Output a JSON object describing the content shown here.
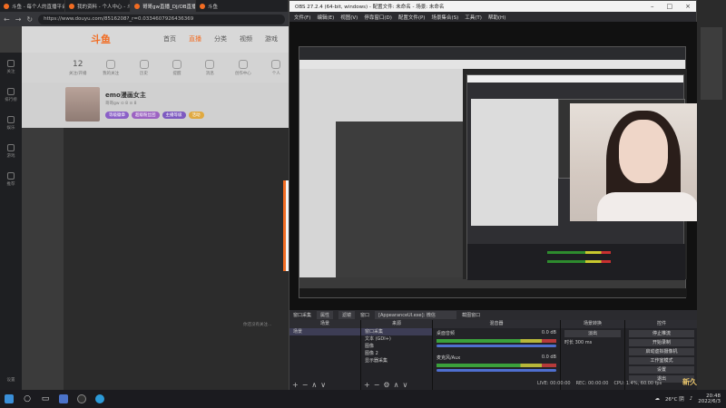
{
  "browser": {
    "tabs": [
      {
        "label": "斗鱼 - 每个人的直播平台"
      },
      {
        "label": "我的资料 - 个人中心 - 斗鱼"
      },
      {
        "label": "哥哥gw直播_DJ/OB直播_斗鱼..."
      },
      {
        "label": "斗鱼"
      }
    ],
    "url": "https://www.douyu.com/8516208?_r=0.0334607926436369"
  },
  "douyu": {
    "logo": "斗鱼",
    "menu": [
      "首页",
      "直播",
      "分类",
      "视频",
      "游戏"
    ],
    "icon_row": [
      {
        "num": "12",
        "label": "关注/开播"
      },
      {
        "label": "我的关注"
      },
      {
        "label": "历史"
      },
      {
        "label": "提醒"
      },
      {
        "label": "消息"
      },
      {
        "label": "创作中心"
      },
      {
        "label": "个人"
      }
    ],
    "anchor": {
      "name": "emo漫画女主",
      "meta": "哥哥gw ⊙ 8 ⊙ 8",
      "badges": [
        "等级徽章",
        "超级粉丝团",
        "主播等级",
        "活动"
      ]
    },
    "sidebar": [
      "关注",
      "排行榜",
      "娱乐",
      "游戏",
      "推荐"
    ],
    "sidebar_bottom": "设置",
    "hint": "你还没有关注..."
  },
  "obs": {
    "title": "OBS 27.2.4 (64-bit, windows) - 配置文件: 未命名 - 场景: 未命名",
    "menu": [
      "文件(F)",
      "编辑(E)",
      "视图(V)",
      "停靠窗口(D)",
      "配置文件(P)",
      "场景集合(S)",
      "工具(T)",
      "帮助(H)"
    ],
    "dock_bar": {
      "window_capture": "窗口采集",
      "props": "属性",
      "filters": "滤镜",
      "window": "窗口",
      "window_value": "[AppearanceUI.exe]: 微信",
      "capture_title": "截图窗口"
    },
    "scenes": {
      "title": "场景",
      "items": [
        "场景"
      ]
    },
    "sources": {
      "title": "来源",
      "items": [
        "窗口采集",
        "文本 (GDI+)",
        "图像",
        "图像 2",
        "显示器采集"
      ]
    },
    "mixer": {
      "title": "混音器",
      "channels": [
        {
          "name": "桌面音频",
          "db": "0.0 dB"
        },
        {
          "name": "麦克风/Aux",
          "db": "0.0 dB"
        }
      ]
    },
    "transitions": {
      "title": "场景转换",
      "type": "淡出",
      "duration_label": "时长",
      "duration": "300 ms"
    },
    "controls": {
      "title": "控件",
      "buttons": [
        "停止推流",
        "开始录制",
        "启动虚拟摄像机",
        "工作室模式",
        "设置",
        "退出"
      ]
    },
    "status": {
      "live": "LIVE: 00:00:00",
      "rec": "REC: 00:00:00",
      "cpu": "CPU: 1.4%, 60.00 fps"
    }
  },
  "watermark": "新久",
  "taskbar": {
    "weather": "26°C 阴",
    "time": "20:48",
    "date": "2022/6/3"
  }
}
